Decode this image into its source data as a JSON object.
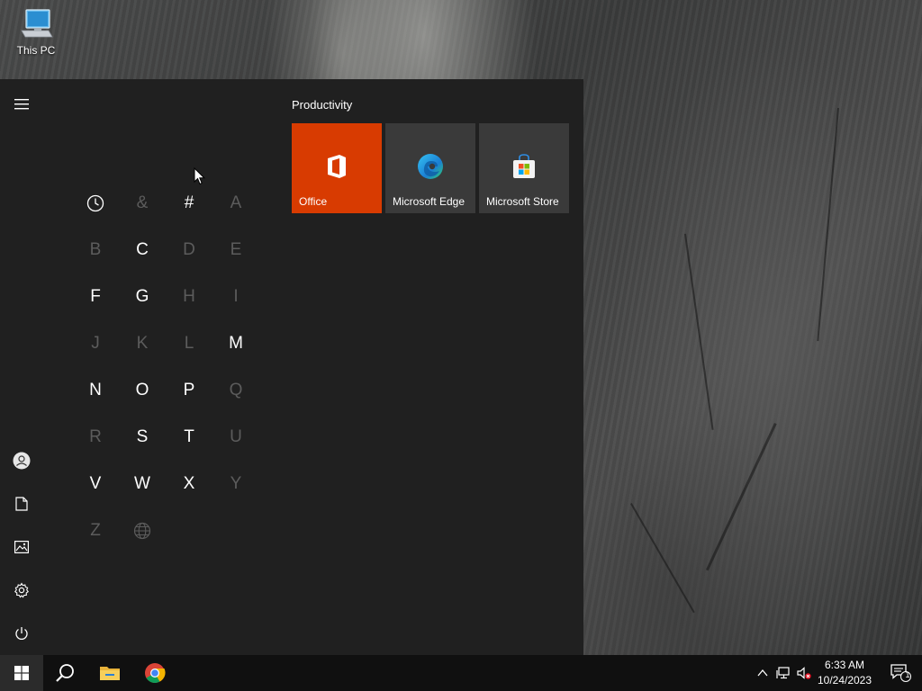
{
  "desktop": {
    "icons": [
      {
        "label": "This PC",
        "icon": "this-pc-icon"
      }
    ]
  },
  "start_menu": {
    "rail": {
      "items": [
        {
          "name": "hamburger-menu",
          "icon": "hamburger-icon"
        },
        {
          "name": "user-account",
          "icon": "user-icon"
        },
        {
          "name": "documents",
          "icon": "document-icon"
        },
        {
          "name": "pictures",
          "icon": "pictures-icon"
        },
        {
          "name": "settings",
          "icon": "gear-icon"
        },
        {
          "name": "power",
          "icon": "power-icon"
        }
      ]
    },
    "letters": [
      {
        "label": "",
        "icon": "clock-icon",
        "enabled": true
      },
      {
        "label": "&",
        "enabled": false
      },
      {
        "label": "#",
        "enabled": true
      },
      {
        "label": "A",
        "enabled": false
      },
      {
        "label": "B",
        "enabled": false
      },
      {
        "label": "C",
        "enabled": true
      },
      {
        "label": "D",
        "enabled": false
      },
      {
        "label": "E",
        "enabled": false
      },
      {
        "label": "F",
        "enabled": true
      },
      {
        "label": "G",
        "enabled": true
      },
      {
        "label": "H",
        "enabled": false
      },
      {
        "label": "I",
        "enabled": false
      },
      {
        "label": "J",
        "enabled": false
      },
      {
        "label": "K",
        "enabled": false
      },
      {
        "label": "L",
        "enabled": false
      },
      {
        "label": "M",
        "enabled": true
      },
      {
        "label": "N",
        "enabled": true
      },
      {
        "label": "O",
        "enabled": true
      },
      {
        "label": "P",
        "enabled": true
      },
      {
        "label": "Q",
        "enabled": false
      },
      {
        "label": "R",
        "enabled": false
      },
      {
        "label": "S",
        "enabled": true
      },
      {
        "label": "T",
        "enabled": true
      },
      {
        "label": "U",
        "enabled": false
      },
      {
        "label": "V",
        "enabled": true
      },
      {
        "label": "W",
        "enabled": true
      },
      {
        "label": "X",
        "enabled": true
      },
      {
        "label": "Y",
        "enabled": false
      },
      {
        "label": "Z",
        "enabled": false
      },
      {
        "label": "",
        "icon": "globe-icon",
        "enabled": false
      }
    ],
    "group": {
      "title": "Productivity",
      "tiles": [
        {
          "label": "Office",
          "icon": "office-icon",
          "color": "#d83b01"
        },
        {
          "label": "Microsoft Edge",
          "icon": "edge-icon",
          "color": "#3a3a3a"
        },
        {
          "label": "Microsoft Store",
          "icon": "store-icon",
          "color": "#3a3a3a"
        }
      ]
    }
  },
  "taskbar": {
    "pinned": [
      {
        "name": "start",
        "icon": "windows-logo-icon"
      },
      {
        "name": "search",
        "icon": "search-icon"
      },
      {
        "name": "file-explorer",
        "icon": "folder-icon"
      },
      {
        "name": "chrome",
        "icon": "chrome-icon"
      }
    ],
    "tray": {
      "icons": [
        "chevron-up-icon",
        "network-icon",
        "volume-muted-icon"
      ],
      "time": "6:33 AM",
      "date": "10/24/2023",
      "notification_count": "1"
    }
  }
}
